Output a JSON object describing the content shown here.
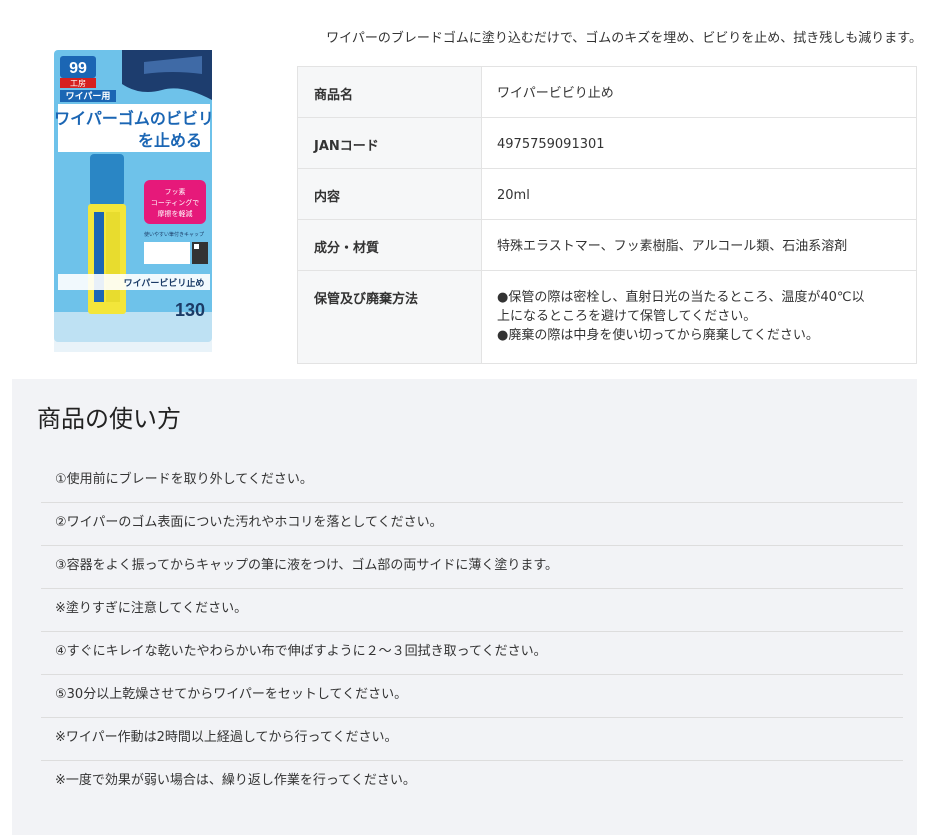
{
  "product": {
    "intro": "ワイパーのブレードゴムに塗り込むだけで、ゴムのキズを埋め、ビビりを止め、拭き残しも減ります。",
    "image_alt": "ワイパービビり止め",
    "package": {
      "logo_text": "99",
      "logo_sub": "工房",
      "tag_text": "ワイパー用",
      "headline_1": "ワイパーゴムのビビリ",
      "headline_2": "を止める",
      "badge_1": "フッ素",
      "badge_2": "コーティングで",
      "badge_3": "摩擦を軽減",
      "cap_note": "使いやすい筆付きキャップ",
      "bottom_name": "ワイパービビリ止め",
      "number": "130"
    },
    "colors": {
      "package_blue": "#6ec2ea",
      "tube_yellow": "#f3e63a",
      "cap_blue": "#2a86c5",
      "headline_blue": "#1b66b4"
    }
  },
  "spec_table": [
    {
      "label": "商品名",
      "value": "ワイパービビり止め"
    },
    {
      "label": "JANコード",
      "value": "4975759091301"
    },
    {
      "label": "内容",
      "value": "20ml"
    },
    {
      "label": "成分・材質",
      "value": "特殊エラストマー、フッ素樹脂、アルコール類、石油系溶剤"
    },
    {
      "label": "保管及び廃棄方法",
      "lines": [
        "●保管の際は密栓し、直射日光の当たるところ、温度が40℃以",
        "上になるところを避けて保管してください。",
        "●廃棄の際は中身を使い切ってから廃棄してください。"
      ]
    }
  ],
  "usage": {
    "title": "商品の使い方",
    "steps": [
      "①使用前にブレードを取り外してください。",
      "②ワイパーのゴム表面についた汚れやホコリを落としてください。",
      "③容器をよく振ってからキャップの筆に液をつけ、ゴム部の両サイドに薄く塗ります。",
      "※塗りすぎに注意してください。",
      "④すぐにキレイな乾いたやわらかい布で伸ばすように２～３回拭き取ってください。",
      "⑤30分以上乾燥させてからワイパーをセットしてください。",
      "※ワイパー作動は2時間以上経過してから行ってください。",
      "※一度で効果が弱い場合は、繰り返し作業を行ってください。"
    ]
  }
}
